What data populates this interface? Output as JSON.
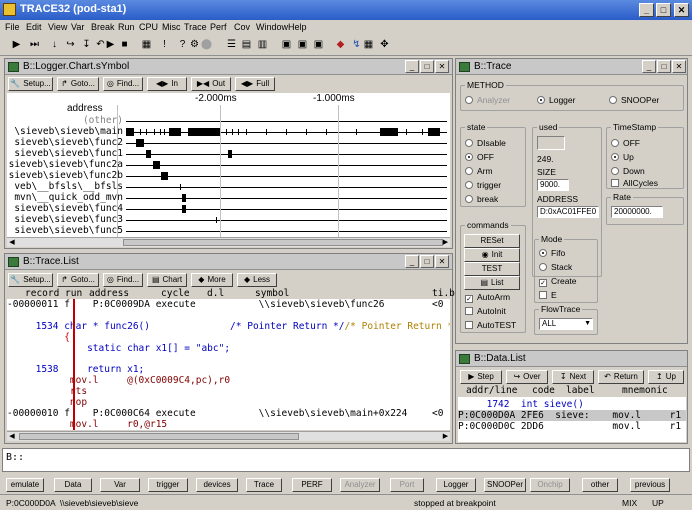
{
  "app": {
    "title": "TRACE32 (pod-sta1)"
  },
  "menu": [
    "File",
    "Edit",
    "View",
    "Var",
    "Break",
    "Run",
    "CPU",
    "Misc",
    "Trace",
    "Perf",
    "Cov",
    "Window",
    "Help"
  ],
  "chart": {
    "title": "B::Logger.Chart.sYmbol",
    "buttons": [
      "Setup...",
      "Goto...",
      "Find...",
      "In",
      "Out",
      "Full"
    ],
    "scale": [
      "-2.000ms",
      "-1.000ms"
    ],
    "header": "address",
    "rows": [
      "(other)",
      "\\sieveb\\sieveb\\main",
      "sieveb\\sieveb\\func2",
      "sieveb\\sieveb\\func1",
      "sieveb\\sieveb\\func2a",
      "sieveb\\sieveb\\func2b",
      "veb\\__bfsls\\__bfsls",
      "mvn\\__quick_odd_mvn",
      "sieveb\\sieveb\\func4",
      "sieveb\\sieveb\\func3",
      "sieveb\\sieveb\\func5"
    ]
  },
  "trace": {
    "title": "B::Trace",
    "method": {
      "label": "METHOD",
      "options": [
        "Analyzer",
        "Logger",
        "SNOOPer"
      ],
      "selected": "Logger"
    },
    "state": {
      "label": "state",
      "options": [
        "DIsable",
        "OFF",
        "Arm",
        "trigger",
        "break"
      ],
      "selected": "OFF"
    },
    "used": {
      "label": "used",
      "value": "249."
    },
    "size": {
      "label": "SIZE",
      "value": "9000."
    },
    "address": {
      "label": "ADDRESS",
      "value": "D:0xAC01FFE0"
    },
    "timestamp": {
      "label": "TimeStamp",
      "options": [
        "OFF",
        "Up",
        "Down"
      ],
      "selected": "Up",
      "allcycles": "AllCycles"
    },
    "rate": {
      "label": "Rate",
      "value": "20000000."
    },
    "commands": {
      "label": "commands",
      "buttons": [
        "RESet",
        "Init",
        "TEST",
        "List"
      ]
    },
    "mode": {
      "label": "Mode",
      "options": [
        "Fifo",
        "Stack",
        "Create",
        "E"
      ],
      "selected": "Fifo",
      "create_checked": true
    },
    "checks": [
      {
        "label": "AutoArm",
        "checked": true
      },
      {
        "label": "AutoInit",
        "checked": false
      },
      {
        "label": "AutoTEST",
        "checked": false
      }
    ],
    "flowtrace": {
      "label": "FlowTrace",
      "value": "ALL"
    }
  },
  "tracelist": {
    "title": "B::Trace.List",
    "buttons": [
      "Setup...",
      "Goto...",
      "Find...",
      "Chart",
      "More",
      "Less"
    ],
    "columns": [
      "record",
      "run",
      "address",
      "cycle",
      "d.l",
      "symbol",
      "ti.b"
    ],
    "lines": [
      {
        "text": "-00000011 f    P:0C0009DA execute           \\\\sieveb\\sieveb\\func26",
        "kind": "rec"
      },
      {
        "text": "",
        "kind": "blank"
      },
      {
        "text": "     1534 char * func26()              /* Pointer Return */",
        "kind": "src"
      },
      {
        "text": "          {",
        "kind": "brace"
      },
      {
        "text": "              static char x1[] = \"abc\";",
        "kind": "src"
      },
      {
        "text": "",
        "kind": "blank"
      },
      {
        "text": "     1538     return x1;",
        "kind": "src"
      },
      {
        "text": "           mov.l     @(0xC0009C4,pc),r0",
        "kind": "asm"
      },
      {
        "text": "           rts",
        "kind": "asm"
      },
      {
        "text": "           nop",
        "kind": "asm"
      },
      {
        "text": "-00000010 f    P:0C000C64 execute           \\\\sieveb\\sieveb\\main+0x224",
        "kind": "rec"
      },
      {
        "text": "           mov.l     r0,@r15",
        "kind": "asm"
      }
    ],
    "right_marks": [
      "<0",
      "",
      "",
      "",
      "",
      "",
      "",
      "",
      "",
      "",
      "<0",
      ""
    ]
  },
  "datalist": {
    "title": "B::Data.List",
    "buttons": [
      "Step",
      "Over",
      "Next",
      "Return",
      "Up"
    ],
    "columns": [
      "addr/line",
      "code",
      "label",
      "mnemonic"
    ],
    "lines": [
      {
        "text": "     1742  int sieve()",
        "kind": "src"
      },
      {
        "text": "P:0C000D0A 2FE6  sieve:    mov.l     r1",
        "kind": "sel"
      },
      {
        "text": "P:0C000D0C 2DD6            mov.l     r1",
        "kind": "asm"
      }
    ]
  },
  "command": {
    "prompt": "B::"
  },
  "softkeys": [
    "emulate",
    "Data",
    "Var",
    "trigger",
    "devices",
    "Trace",
    "PERF",
    "Analyzer",
    "Port",
    "Logger",
    "SNOOPer",
    "Onchip",
    "other",
    "previous"
  ],
  "softkeys_disabled": [
    "Analyzer",
    "Port",
    "Onchip"
  ],
  "status": {
    "location": "P:0C000D0A  \\\\sieveb\\sieveb\\sieve",
    "state": "stopped at breakpoint",
    "mode": "MIX",
    "dir": "UP"
  }
}
